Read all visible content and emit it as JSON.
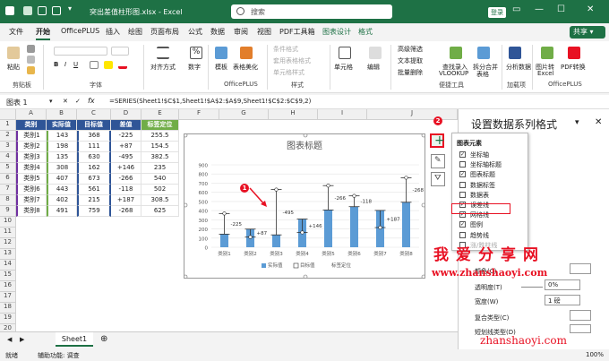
{
  "title_bar": {
    "filename": "突出差值柱形图.xlsx  -  Excel",
    "search_placeholder": "搜索",
    "login": "登录",
    "minimize": "—",
    "maximize": "☐",
    "close": "✕"
  },
  "ribbon_tabs": [
    "文件",
    "开始",
    "OfficePLUS",
    "插入",
    "绘图",
    "页面布局",
    "公式",
    "数据",
    "审阅",
    "视图",
    "PDF工具箱",
    "图表设计",
    "格式"
  ],
  "share": "共享",
  "ribbon": {
    "paste": "粘贴",
    "clipboard": "剪贴板",
    "font_group": "字体",
    "align": "对齐方式",
    "number": "数字",
    "cond_format": "条件格式",
    "table_format": "套用表格格式",
    "cell_style": "单元格样式",
    "styles": "样式",
    "template": "模板",
    "beautify": "表格美化",
    "officeplus": "OfficePLUS",
    "cells": "单元格",
    "editing": "编辑",
    "advanced_filter": "高级筛选",
    "text_extract": "文本提取",
    "batch_delete": "批量删除",
    "lookup": "查找录入",
    "vlookup": "VLOOKUP",
    "split_merge": "拆分合并",
    "merge_table": "表格",
    "tools": "便捷工具",
    "analysis": "分析数据",
    "addins": "加载项",
    "image_to_table": "图片转",
    "excel": "Excel",
    "pdf_convert": "PDF转换",
    "officeplus2": "OfficePLUS"
  },
  "formula_bar": {
    "name_box": "图表 1",
    "fx": "fx",
    "formula": "=SERIES(Sheet1!$C$1,Sheet1!$A$2:$A$9,Sheet1!$C$2:$C$9,2)"
  },
  "columns": [
    "A",
    "B",
    "C",
    "D",
    "E",
    "F",
    "G",
    "H",
    "I",
    "J"
  ],
  "rows": [
    "1",
    "2",
    "3",
    "4",
    "5",
    "6",
    "7",
    "8",
    "9",
    "10",
    "11",
    "12",
    "13",
    "14",
    "15",
    "16",
    "17",
    "18",
    "19",
    "20"
  ],
  "table": {
    "headers": [
      "类别",
      "实际值",
      "目标值",
      "差值",
      "标签定位"
    ],
    "rows": [
      [
        "类别1",
        "143",
        "368",
        "-225",
        "255.5"
      ],
      [
        "类别2",
        "198",
        "111",
        "+87",
        "154.5"
      ],
      [
        "类别3",
        "135",
        "630",
        "-495",
        "382.5"
      ],
      [
        "类别4",
        "308",
        "162",
        "+146",
        "235"
      ],
      [
        "类别5",
        "407",
        "673",
        "-266",
        "540"
      ],
      [
        "类别6",
        "443",
        "561",
        "-118",
        "502"
      ],
      [
        "类别7",
        "402",
        "215",
        "+187",
        "308.5"
      ],
      [
        "类别8",
        "491",
        "759",
        "-268",
        "625"
      ]
    ]
  },
  "chart_data": {
    "type": "bar",
    "title": "图表标题",
    "categories": [
      "类别1",
      "类别2",
      "类别3",
      "类别4",
      "类别5",
      "类别6",
      "类别7",
      "类别8"
    ],
    "series": [
      {
        "name": "实际值",
        "values": [
          143,
          198,
          135,
          308,
          407,
          443,
          402,
          491
        ],
        "color": "#5b9bd5"
      },
      {
        "name": "目标值",
        "values": [
          368,
          111,
          630,
          162,
          673,
          561,
          215,
          759
        ]
      },
      {
        "name": "标签定位",
        "values": [
          255.5,
          154.5,
          382.5,
          235,
          540,
          502,
          308.5,
          625
        ]
      }
    ],
    "diff_labels": [
      "-225",
      "+87",
      "-495",
      "+146",
      "-266",
      "-118",
      "+187",
      "-268"
    ],
    "yticks": [
      "0",
      "100",
      "200",
      "300",
      "400",
      "500",
      "600",
      "700",
      "800",
      "900"
    ],
    "ylim": [
      0,
      900
    ],
    "legend": "bottom"
  },
  "sheet_tab": "Sheet1",
  "status": {
    "ready": "就绪",
    "accessibility": "辅助功能: 调查",
    "zoom": "100%"
  },
  "pane": {
    "title": "设置数据系列格式",
    "color": "颜色(C)",
    "transparency": "透明度(T)",
    "transparency_val": "0%",
    "width": "宽度(W)",
    "width_val": "1 磅",
    "compound": "复合类型(C)",
    "dash": "短划线类型(D)"
  },
  "chart_elements": {
    "title": "图表元素",
    "items": [
      {
        "label": "坐标轴",
        "checked": true
      },
      {
        "label": "坐标轴标题",
        "checked": false
      },
      {
        "label": "图表标题",
        "checked": true
      },
      {
        "label": "数据标签",
        "checked": false
      },
      {
        "label": "数据表",
        "checked": false
      },
      {
        "label": "误差线",
        "checked": true
      },
      {
        "label": "网格线",
        "checked": true
      },
      {
        "label": "图例",
        "checked": true
      },
      {
        "label": "趋势线",
        "checked": false
      },
      {
        "label": "涨/跌柱线",
        "checked": false
      }
    ]
  },
  "annotations": [
    "1",
    "2",
    "3"
  ],
  "watermark": {
    "brand": "我爱分享网",
    "url": "www.zhanshaoyi.com",
    "url2": "zhanshaoyi.com"
  }
}
